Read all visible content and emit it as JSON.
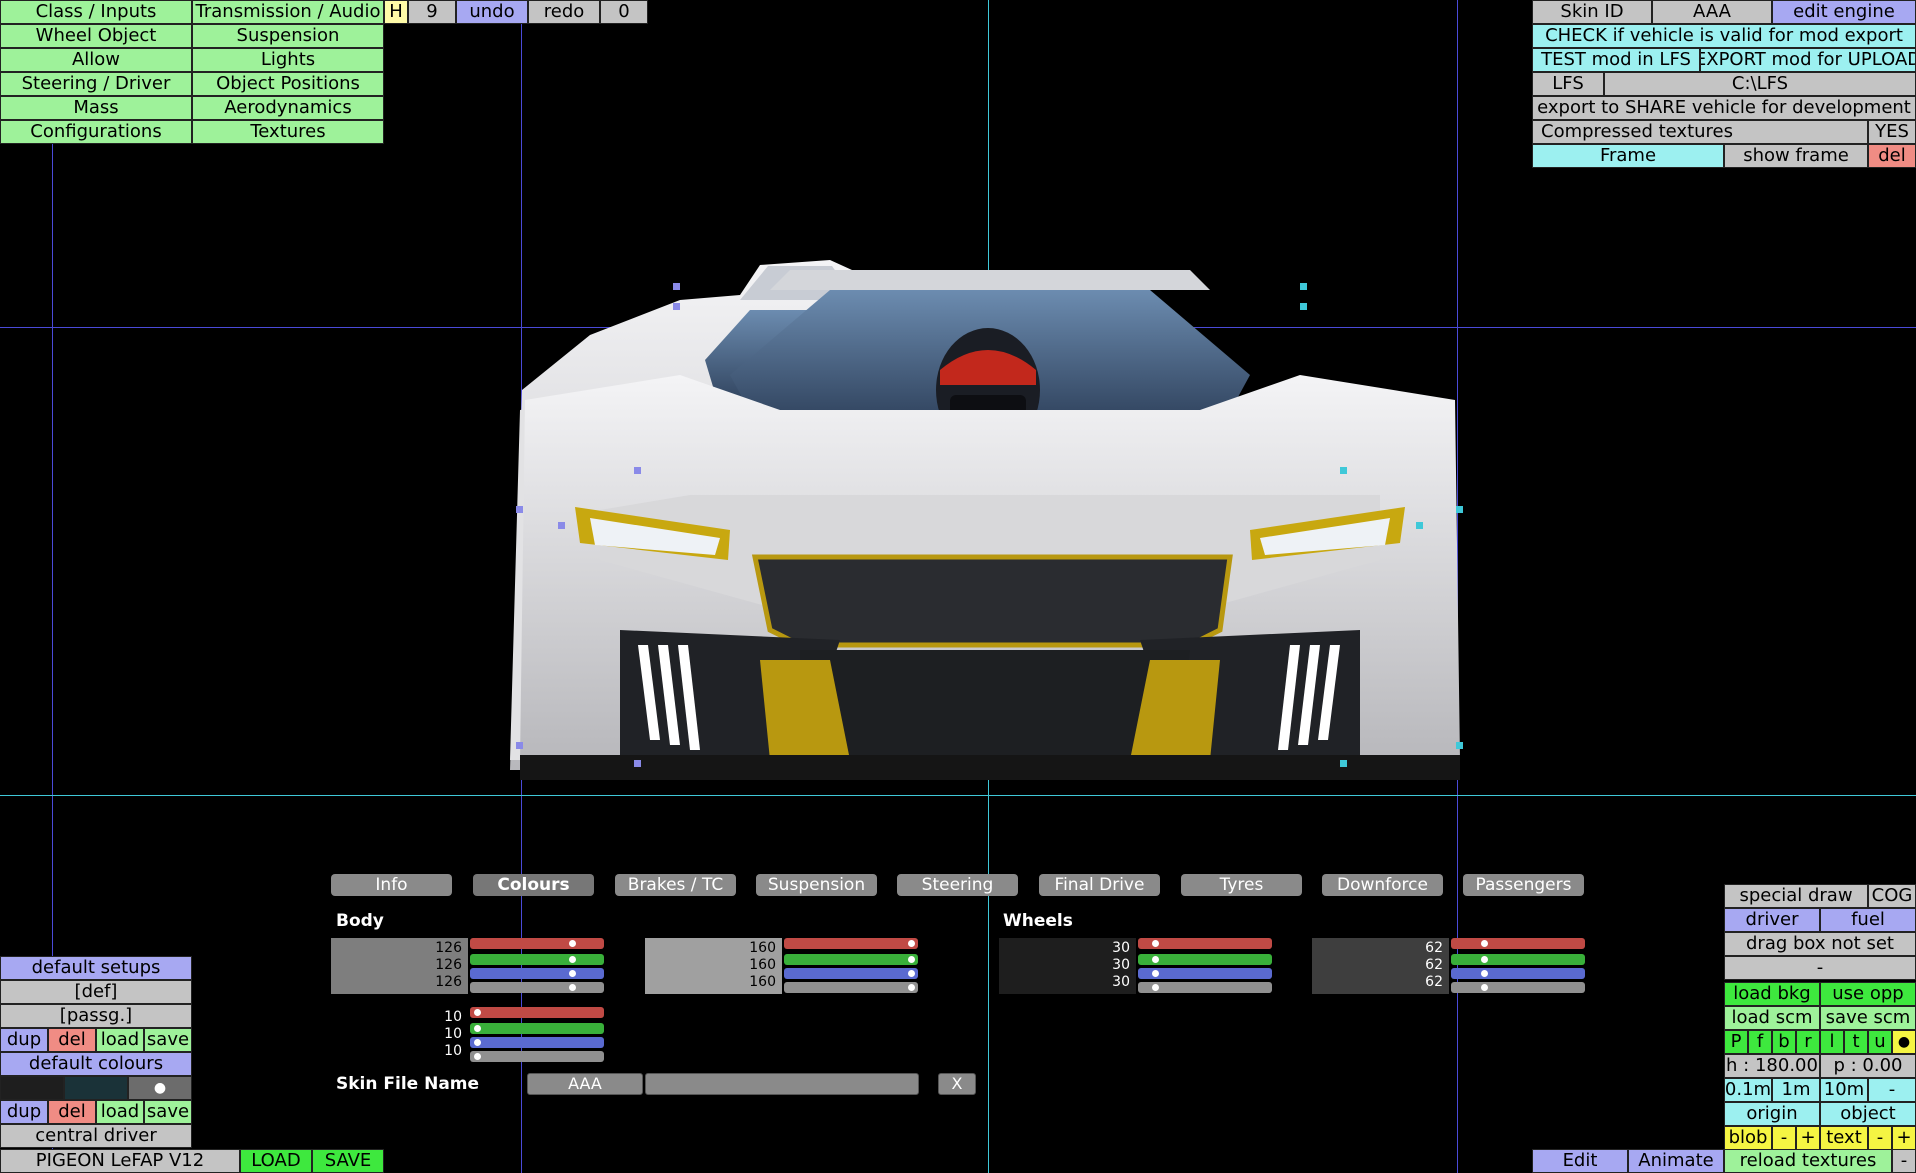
{
  "menu": {
    "left_col": [
      "Class / Inputs",
      "Wheel Object",
      "Allow",
      "Steering / Driver",
      "Mass",
      "Configurations"
    ],
    "right_col": [
      "Transmission / Audio",
      "Suspension",
      "Lights",
      "Object Positions",
      "Aerodynamics",
      "Textures"
    ],
    "h_label": "H",
    "count": "9",
    "undo": "undo",
    "redo": "redo",
    "zero": "0"
  },
  "export_panel": {
    "skin_id_label": "Skin ID",
    "skin_id_value": "AAA",
    "edit_engine": "edit engine",
    "check_valid": "CHECK if vehicle is valid for mod export",
    "test_mod": "TEST mod in LFS",
    "export_mod": "EXPORT mod for UPLOAD",
    "lfs_label": "LFS",
    "lfs_path": "C:\\LFS",
    "export_share": "export to SHARE vehicle for development",
    "compressed": "Compressed textures",
    "compressed_value": "YES",
    "frame": "Frame",
    "show_frame": "show frame",
    "del": "del"
  },
  "tabs": [
    "Info",
    "Colours",
    "Brakes / TC",
    "Suspension",
    "Steering",
    "Final Drive",
    "Tyres",
    "Downforce",
    "Passengers"
  ],
  "active_tab": "Colours",
  "colours": {
    "body_label": "Body",
    "wheels_label": "Wheels",
    "body1": [
      "126",
      "126",
      "126"
    ],
    "body2": [
      "160",
      "160",
      "160"
    ],
    "body3": [
      "10",
      "10",
      "10"
    ],
    "wheels1": [
      "30",
      "30",
      "30"
    ],
    "wheels2": [
      "62",
      "62",
      "62"
    ],
    "skin_file_label": "Skin File Name",
    "skin_file_value": "AAA",
    "skin_file_x": "X"
  },
  "left_panel": {
    "default_setups": "default setups",
    "def": "[def]",
    "passg": "[passg.]",
    "dup": "dup",
    "del": "del",
    "load": "load",
    "save": "save",
    "default_colours": "default colours",
    "dot": "●",
    "central_driver": "central driver",
    "vehicle_name": "PIGEON LeFAP V12",
    "load_caps": "LOAD",
    "save_caps": "SAVE"
  },
  "right_panel": {
    "special_draw": "special draw",
    "cog": "COG",
    "driver": "driver",
    "fuel": "fuel",
    "drag_box": "drag box not set",
    "dash": "-",
    "load_bkg": "load bkg",
    "use_opp": "use opp",
    "load_scm": "load scm",
    "save_scm": "save scm",
    "views": [
      "P",
      "f",
      "b",
      "r",
      "l",
      "t",
      "u"
    ],
    "view_dot": "●",
    "heading": "h : 180.00",
    "pitch": "p : 0.00",
    "steps": [
      "0.1m",
      "1m",
      "10m"
    ],
    "step_minus": "-",
    "origin": "origin",
    "object": "object",
    "blob": "blob",
    "minus": "-",
    "plus": "+",
    "text": "text",
    "reload_textures": "reload textures",
    "edit": "Edit",
    "animate": "Animate"
  },
  "colors": {
    "green": "#9ef29a",
    "grey": "#c4c4c4",
    "blue": "#a7a8f2",
    "cyan": "#9cf0f0",
    "red": "#f08c84",
    "bright_green": "#3ee83e",
    "yellow": "#f5f543"
  }
}
